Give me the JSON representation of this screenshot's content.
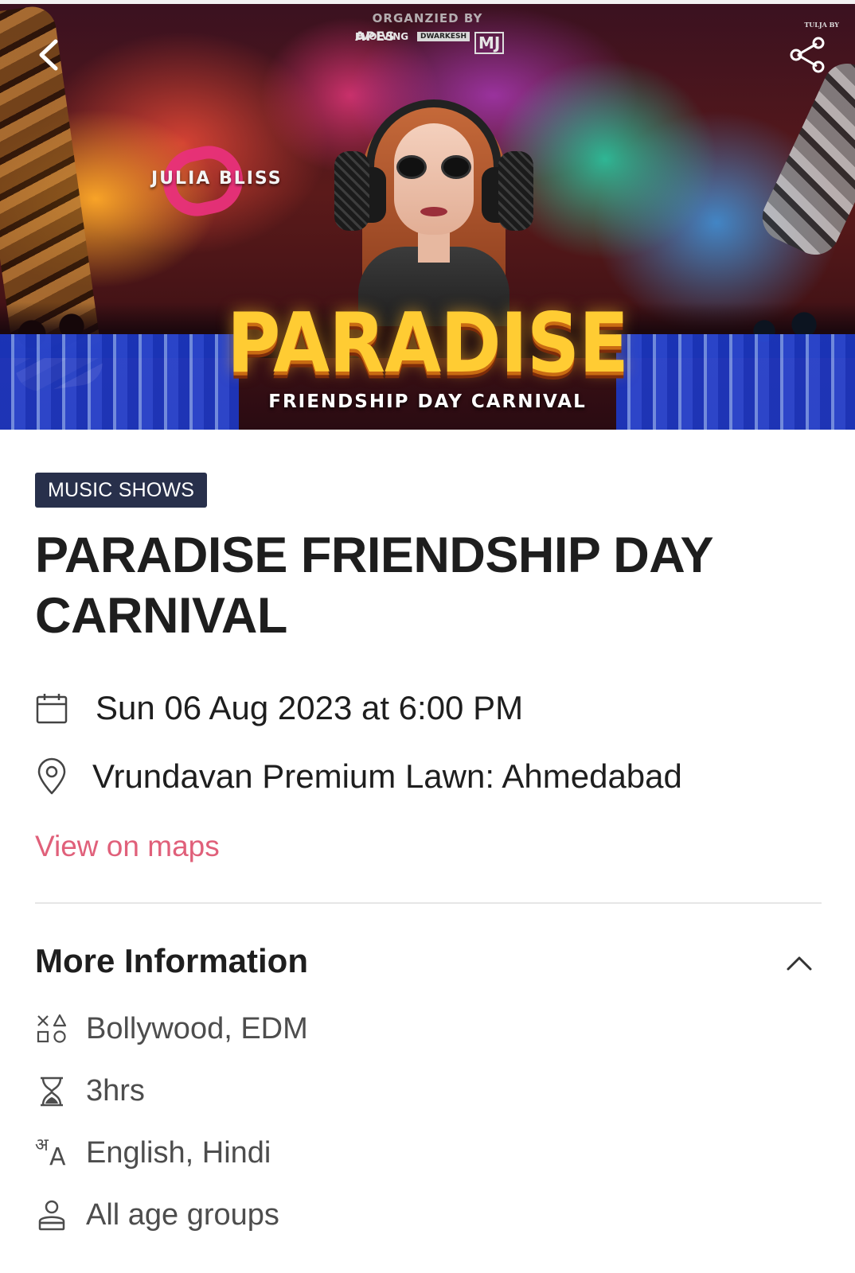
{
  "banner": {
    "organized_by": "ORGANZIED BY",
    "sponsor_1_top": "EVOLVING",
    "sponsor_1_bottom": "APES",
    "sponsor_2": "DWARKESH",
    "sponsor_3": "MJ",
    "corner_brand": "TULJA BY",
    "artist_name": "JULIA BLISS",
    "title": "PARADISE",
    "subtitle": "FRIENDSHIP DAY CARNIVAL"
  },
  "event": {
    "category": "MUSIC SHOWS",
    "title": "PARADISE FRIENDSHIP DAY CARNIVAL",
    "datetime": "Sun 06 Aug 2023 at 6:00 PM",
    "venue": "Vrundavan Premium Lawn: Ahmedabad",
    "maps_link": "View on maps"
  },
  "more_info": {
    "heading": "More Information",
    "genre": "Bollywood, EDM",
    "duration": "3hrs",
    "languages": "English, Hindi",
    "age": "All age groups"
  },
  "icons": {
    "back": "chevron-left-icon",
    "share": "share-icon",
    "date": "calendar-icon",
    "venue": "map-pin-icon",
    "collapse": "chevron-up-icon",
    "genre": "shapes-icon",
    "duration": "hourglass-icon",
    "language": "translate-icon",
    "age": "user-icon"
  },
  "colors": {
    "badge_bg": "#28304b",
    "link": "#e0607a",
    "text": "#1e1e1e",
    "muted": "#4d4d4d"
  }
}
